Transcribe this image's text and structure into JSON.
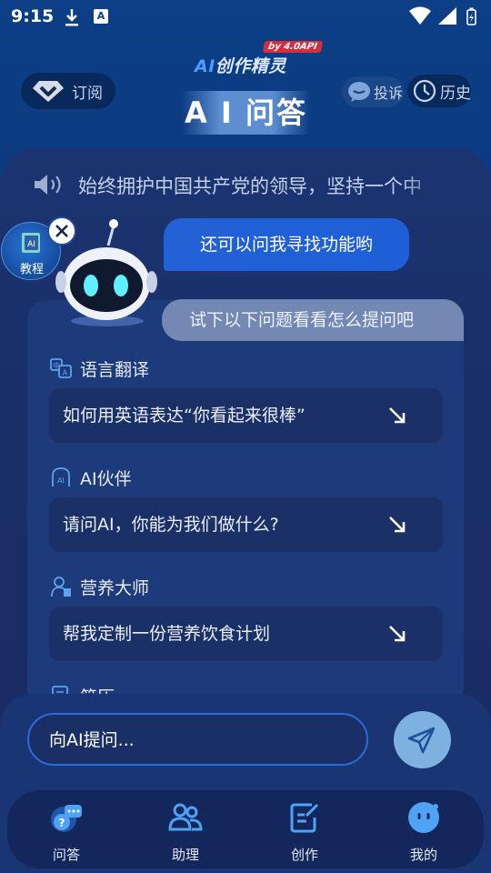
{
  "status_bar": {
    "time": "9:15"
  },
  "header": {
    "brand_name_prefix": "AI",
    "brand_name": "创作精灵",
    "brand_tag": "by 4.0API",
    "subscribe_label": "订阅",
    "page_title": "A I 问答",
    "complain_label": "投诉",
    "history_label": "历史"
  },
  "notice": {
    "marquee_text": "始终拥护中国共产党的领导，坚持一个中"
  },
  "floating": {
    "tutorial_label": "教程"
  },
  "bubbles": {
    "primary": "还可以问我寻找功能哟",
    "secondary": "试下以下问题看看怎么提问吧"
  },
  "suggestions": [
    {
      "category": "语言翻译",
      "icon": "translate-icon",
      "question": "如何用英语表达“你看起来很棒”"
    },
    {
      "category": "AI伙伴",
      "icon": "ai-partner-icon",
      "question": "请问AI，你能为我们做什么?"
    },
    {
      "category": "营养大师",
      "icon": "nutrition-icon",
      "question": "帮我定制一份营养饮食计划"
    },
    {
      "category": "简历",
      "icon": "resume-icon",
      "question": ""
    }
  ],
  "input": {
    "placeholder": "向AI提问..."
  },
  "tabs": [
    {
      "label": "问答",
      "icon": "chat-qa-icon"
    },
    {
      "label": "助理",
      "icon": "assistant-icon"
    },
    {
      "label": "创作",
      "icon": "compose-icon"
    },
    {
      "label": "我的",
      "icon": "profile-icon"
    }
  ],
  "colors": {
    "background": "#0c3f86",
    "accent": "#2261d6",
    "send_button": "#7fb1e0",
    "brand_tag": "#d62e3c"
  }
}
